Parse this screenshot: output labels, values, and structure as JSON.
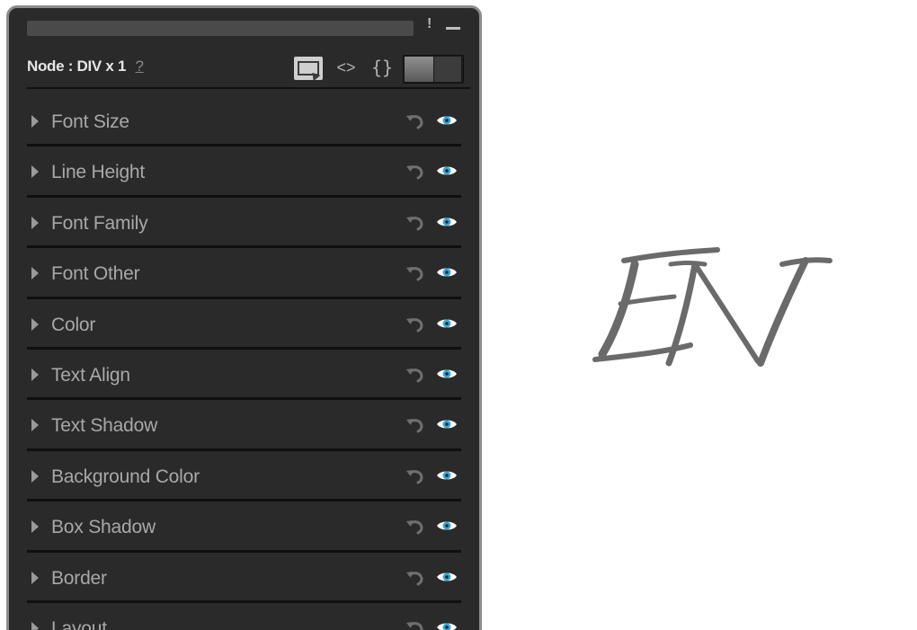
{
  "panel": {
    "titlebar": {
      "alert_glyph": "!",
      "minimize_glyph": "—"
    },
    "node": {
      "label": "Node : DIV x 1",
      "help": "?",
      "code_glyph": "<>",
      "brace_glyph": "{}"
    },
    "properties": [
      {
        "label": "Font Size"
      },
      {
        "label": "Line Height"
      },
      {
        "label": "Font Family"
      },
      {
        "label": "Font Other"
      },
      {
        "label": "Color"
      },
      {
        "label": "Text Align"
      },
      {
        "label": "Text Shadow"
      },
      {
        "label": "Background Color"
      },
      {
        "label": "Box Shadow"
      },
      {
        "label": "Border"
      },
      {
        "label": "Layout"
      }
    ]
  },
  "logo": {
    "text": "EN"
  },
  "colors": {
    "panel_bg": "#2a2a2a",
    "panel_border": "#8c8c8c",
    "label_text": "#a8a8a8",
    "eye_accent": "#3aa6d8",
    "logo_gray": "#6a6a6a"
  }
}
